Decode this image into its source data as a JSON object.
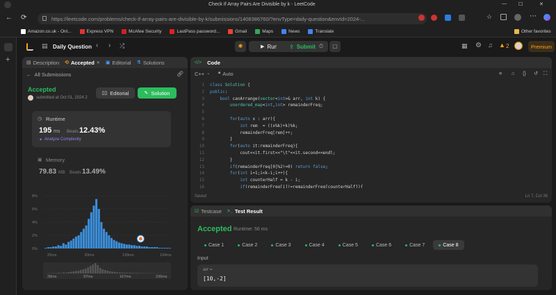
{
  "browser": {
    "window_title": "Check If Array Pairs Are Divisible by k - LeetCode",
    "url": "https://leetcode.com/problems/check-if-array-pairs-are-divisible-by-k/submissions/1408386760/?envType=daily-question&envId=2024-...",
    "bookmarks": [
      "Amazon.co.uk - Onl...",
      "Express VPN",
      "McAfee Security",
      "LastPass password...",
      "Gmail",
      "Maps",
      "News",
      "Translate"
    ],
    "other_favorites": "Other favorites"
  },
  "nav": {
    "daily_question": "Daily Question",
    "run": "Run",
    "submit": "Submit",
    "streak": "2",
    "premium": "Premium"
  },
  "left": {
    "tabs": [
      "Description",
      "Accepted",
      "Editorial",
      "Solutions"
    ],
    "all_submissions": "All Submissions",
    "status": "Accepted",
    "submitted": "submitted at Oct 01, 2024 2",
    "editorial_btn": "Editorial",
    "solution_btn": "Solution",
    "runtime_label": "Runtime",
    "runtime_value": "195",
    "runtime_unit": "ms",
    "beats_label": "Beats",
    "runtime_beats": "12.43%",
    "analyze": "Analyze Complexity",
    "memory_label": "Memory",
    "memory_value": "79.83",
    "memory_unit": "MB",
    "memory_beats": "13.49%"
  },
  "chart_data": {
    "type": "bar",
    "y_ticks": [
      "8%",
      "6%",
      "4%",
      "2%",
      "0%"
    ],
    "x_ticks": [
      "25ms",
      "83ms",
      "139ms",
      "194ms"
    ],
    "mini_x_ticks": [
      "28ms",
      "97ms",
      "167ms",
      "236ms"
    ],
    "ylim": [
      0,
      8
    ],
    "values": [
      0.1,
      0.2,
      0.2,
      0.3,
      0.3,
      0.5,
      0.4,
      0.8,
      0.6,
      1.0,
      1.2,
      1.5,
      1.8,
      2.0,
      2.5,
      3.0,
      3.5,
      4.5,
      5.5,
      6.5,
      7.5,
      6.0,
      4.0,
      3.0,
      2.5,
      2.0,
      1.6,
      1.3,
      1.1,
      0.9,
      0.8,
      0.7,
      0.6,
      0.6,
      0.5,
      0.5,
      0.4,
      0.4,
      0.3,
      0.3,
      0.3,
      0.2,
      0.2,
      0.2,
      0.2,
      0.1,
      0.1,
      0.1,
      0.1,
      0.1
    ]
  },
  "code": {
    "header": "Code",
    "language": "C++",
    "auto": "Auto",
    "saved": "Saved",
    "cursor": "Ln 7, Col 36",
    "lines": [
      "class Solution {",
      "public:",
      "    bool canArrange(vector<int>& arr, int k) {",
      "        unordered_map<int,int> remainderFreq;",
      "",
      "        for(auto x : arr){",
      "            int rem  = ((x%k)+k)%k;",
      "            remainderFreq[rem]++;",
      "        }",
      "        for(auto it:remainderFreq){",
      "            cout<<it.first<<\"\\t\"<<it.second<<endl;",
      "        }",
      "        if(remainderFreq[0]%2!=0) return false;",
      "        for(int i=1;i<k-i;i++){",
      "            int counterHalf = k - i;",
      "            if(remainderFreq[i]!=remainderFreq[counterHalf]){"
    ]
  },
  "result": {
    "tabs": [
      "Testcase",
      "Test Result"
    ],
    "status": "Accepted",
    "runtime": "Runtime: 56 ms",
    "cases": [
      "Case 1",
      "Case 2",
      "Case 3",
      "Case 4",
      "Case 5",
      "Case 6",
      "Case 7",
      "Case 8"
    ],
    "input_label": "Input",
    "var_label": "arr =",
    "var_value": "[10,-2]"
  }
}
